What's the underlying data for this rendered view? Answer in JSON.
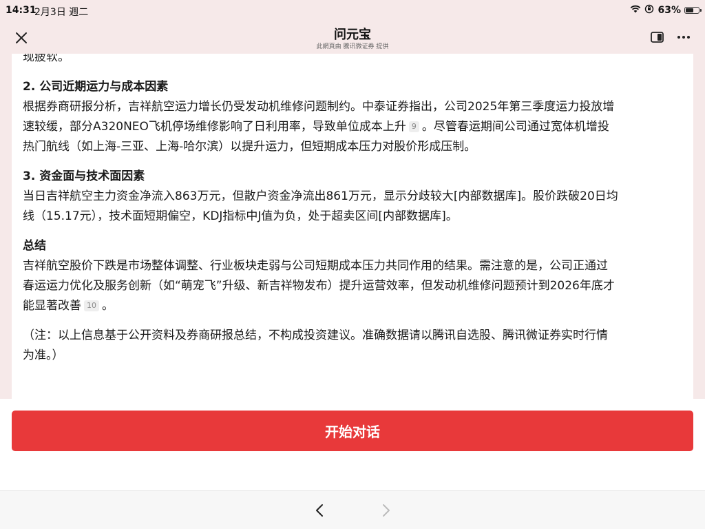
{
  "status_bar": {
    "time": "14:31",
    "date": "2月3日 週二",
    "battery": "63%",
    "battery_level": 0.63
  },
  "header": {
    "title": "问元宝",
    "subtitle": "此網頁由 騰讯微证券 提供"
  },
  "content": {
    "cut_top_line": "现疲软。",
    "section2": {
      "heading": "2. 公司近期运力与成本因素",
      "line1": "根据券商研报分析，吉祥航空运力增长仍受发动机维修问题制约。中泰证券指出，公司2025年第三季度运力投放增",
      "line2": "速较缓，部分A320NEO飞机停场维修影响了日利用率，导致单位成本上升",
      "cite": "9",
      "line2_after": "。尽管春运期间公司通过宽体机增投",
      "line3": "热门航线（如上海-三亚、上海-哈尔滨）以提升运力，但短期成本压力对股价形成压制。"
    },
    "section3": {
      "heading": "3. 资金面与技术面因素",
      "line1": "当日吉祥航空主力资金净流入863万元，但散户资金净流出861万元，显示分歧较大[内部数据库]。股价跌破20日均",
      "line2": "线（15.17元），技术面短期偏空，KDJ指标中J值为负，处于超卖区间[内部数据库]。"
    },
    "summary": {
      "heading": "总结",
      "line1": "吉祥航空股价下跌是市场整体调整、行业板块走弱与公司短期成本压力共同作用的结果。需注意的是，公司正通过",
      "line2": "春运运力优化及服务创新（如“萌宠飞”升级、新吉祥物发布）提升运营效率，但发动机维修问题预计到2026年底才",
      "line3": "能显著改善",
      "cite": "10",
      "line3_after": "。"
    },
    "note": {
      "line1": "（注：以上信息基于公开资料及券商研报总结，不构成投资建议。准确数据请以腾讯自选股、腾讯微证券实时行情",
      "line2": "为准。）"
    }
  },
  "actions": {
    "start_label": "开始对话"
  },
  "colors": {
    "accent": "#e8393a",
    "background": "#f6e9e9",
    "card": "#ffffff"
  },
  "icons": {
    "close": "close-icon",
    "panel": "sidebar-panel-icon",
    "more": "more-dots-icon",
    "back": "chevron-left-icon",
    "forward": "chevron-right-icon",
    "wifi": "wifi-icon",
    "rotation_lock": "rotation-lock-icon",
    "battery": "battery-icon"
  }
}
